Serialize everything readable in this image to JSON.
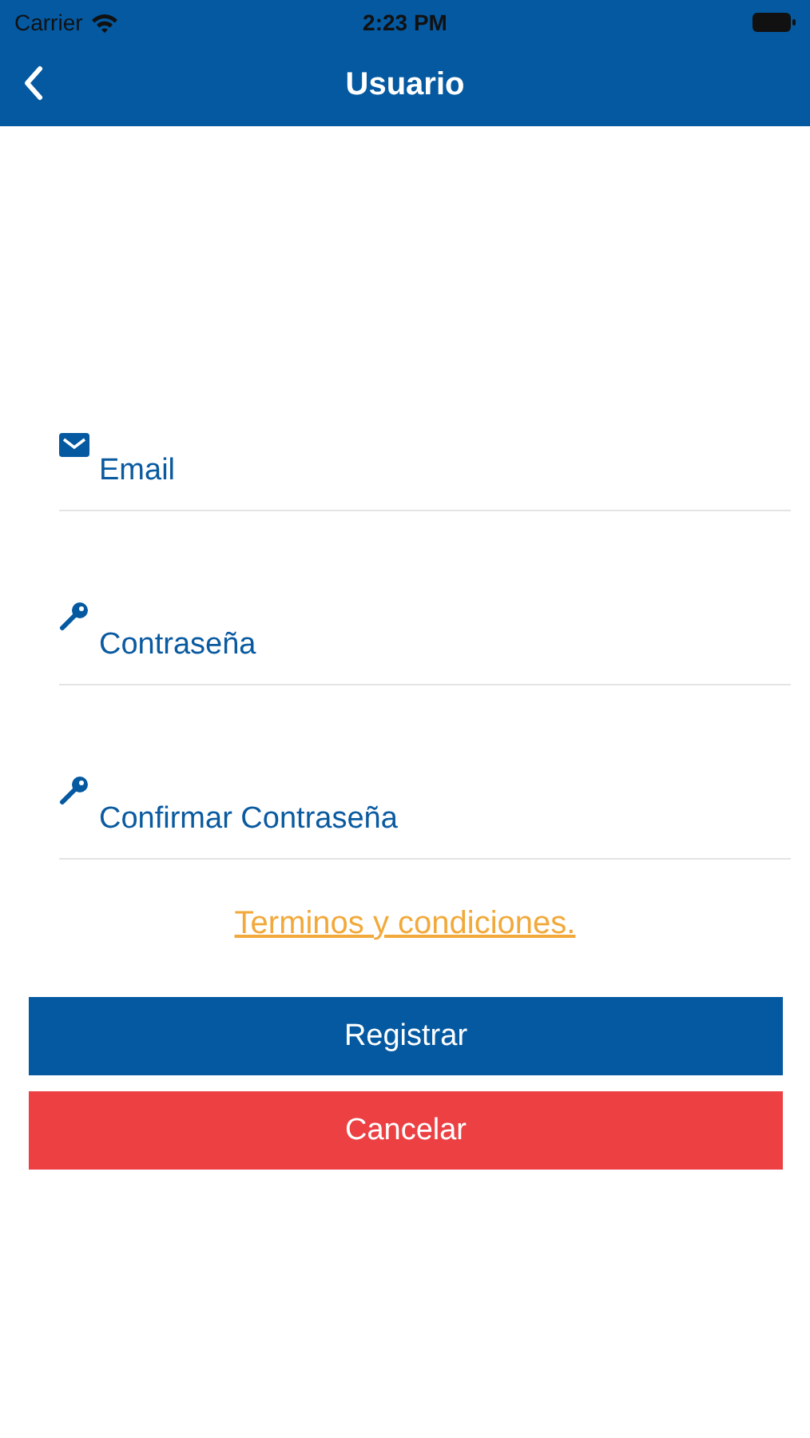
{
  "status_bar": {
    "carrier": "Carrier",
    "time": "2:23 PM"
  },
  "nav": {
    "title": "Usuario"
  },
  "fields": [
    {
      "kind": "email",
      "placeholder": "Email"
    },
    {
      "kind": "key",
      "placeholder": "Contraseña"
    },
    {
      "kind": "key",
      "placeholder": "Confirmar Contraseña"
    }
  ],
  "terms_link": "Terminos y condiciones.",
  "buttons": [
    {
      "kind": "primary",
      "label": "Registrar"
    },
    {
      "kind": "danger",
      "label": "Cancelar"
    }
  ]
}
